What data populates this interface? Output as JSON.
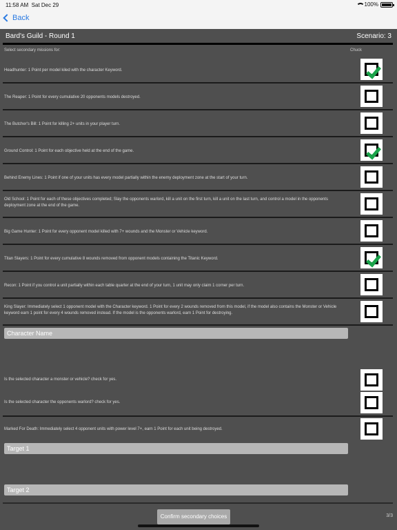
{
  "status_bar": {
    "time": "11:58 AM",
    "date": "Sat Dec 29",
    "battery": "100%"
  },
  "nav": {
    "back_label": "Back"
  },
  "header": {
    "title": "Bard's Guild - Round 1",
    "scenario": "Scenario: 3"
  },
  "subhead": {
    "prompt": "Select secondary missions for:",
    "player": "Chuck"
  },
  "missions": [
    {
      "text": "Headhunter: 1 Point per model kiled with the character Keyword.",
      "checked": true
    },
    {
      "text": "The Reaper: 1 Point for every cumulative 20 opponents models destroyed.",
      "checked": false
    },
    {
      "text": "The Butcher's Bill: 1 Point for killing 2+ units in your player turn.",
      "checked": false
    },
    {
      "text": "Ground Control: 1 Point for each objective held at the end of the game.",
      "checked": true
    },
    {
      "text": "Behind Enemy Lines: 1 Point if one of your units has every model partially within the enemy deployment zone at the start of your turn.",
      "checked": false
    },
    {
      "text": "Old School: 1 Point for each of these objectives completed; Slay the opponents warlord, kill a unit on the first turn, kill a unit on the last turn, and control a model in the opponents deployment zone at the end of the game.",
      "checked": false
    },
    {
      "text": "Big Game Hunter: 1 Point for every opponent model killed with 7+ wounds and the Monster or Vehicle keyword.",
      "checked": false
    },
    {
      "text": "Titan Slayers: 1 Point for every cumulative 8 wounds removed from opponent models containing the Titanic Keyword.",
      "checked": true
    },
    {
      "text": "Recon: 1 Point if you control a unit partially within each table quarter at the end of your turn, 1 unit may only claim 1 corner per turn.",
      "checked": false
    },
    {
      "text": "King Slayer: Immediately select 1 opponent model with the Character keyword. 1 Point for every 2 wounds removed from this model, if the model also contains the Monster or Vehicle keyword earn 1 point for every 4 wounds removed instead. If the model is the opponents warlord, earn 1 Point for destroying.",
      "checked": false
    }
  ],
  "character_field": {
    "placeholder": "Character Name"
  },
  "questions": [
    {
      "text": "Is the selected character a monster or vehicle? check for yes.",
      "checked": false
    },
    {
      "text": "Is the selected character the opponents warlord? check for yes.",
      "checked": false
    }
  ],
  "marked_for_death": {
    "text": "Marked For Death: Immediately select 4 opponent units with power level 7+, earn 1 Point for each unit being destroyed.",
    "checked": false
  },
  "targets": [
    {
      "placeholder": "Target 1"
    },
    {
      "placeholder": "Target 2"
    }
  ],
  "footer": {
    "confirm_label": "Confirm secondary choices",
    "page": "3/3"
  }
}
